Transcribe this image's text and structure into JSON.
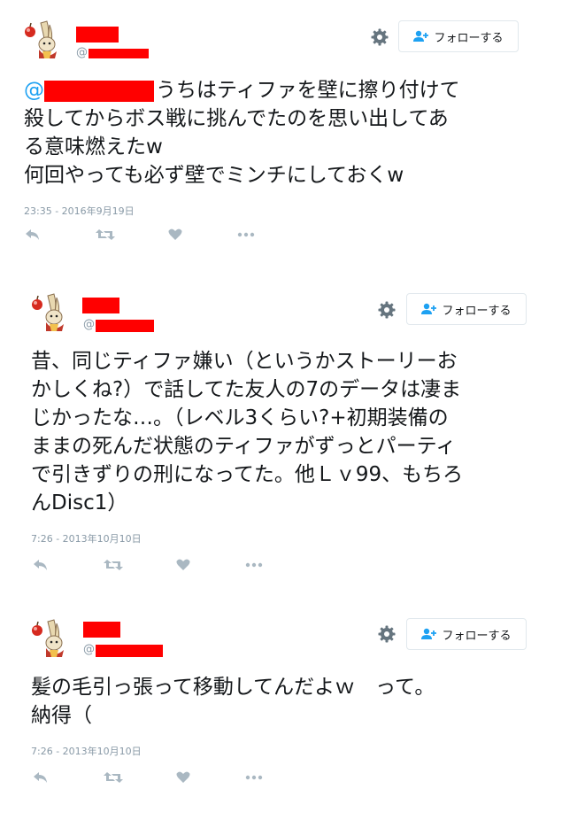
{
  "follow_label": "フォローする",
  "accent_color": "#1da1f2",
  "redaction_color": "#ff0000",
  "tweets": [
    {
      "at_prefix": "@",
      "mention_prefix": "@",
      "lines": [
        "うちはティファを壁に擦り付けて",
        "殺してからボス戦に挑んでたのを思い出してあ",
        "る意味燃えたw",
        "何回やっても必ず壁でミンチにしておくw"
      ],
      "timestamp": "23:35 - 2016年9月19日"
    },
    {
      "at_prefix": "@",
      "lines": [
        "昔、同じティファ嫌い（というかストーリーお",
        "かしくね?）で話してた友人の7のデータは凄ま",
        "じかったな…。（レベル3くらい?+初期装備の",
        "ままの死んだ状態のティファがずっとパーティ",
        "で引きずりの刑になってた。他Ｌｖ99、もちろ",
        "んDisc1）"
      ],
      "timestamp": "7:26 - 2013年10月10日"
    },
    {
      "at_prefix": "@",
      "lines": [
        "髪の毛引っ張って移動してんだよｗ　って。",
        "納得（"
      ],
      "timestamp": "7:26 - 2013年10月10日"
    }
  ],
  "icons": {
    "avatar": "rabbit-mage-avatar-icon",
    "settings": "gear-icon",
    "follow": "person-add-icon",
    "reply": "reply-icon",
    "retweet": "retweet-icon",
    "like": "heart-icon",
    "more": "more-dots-icon"
  }
}
